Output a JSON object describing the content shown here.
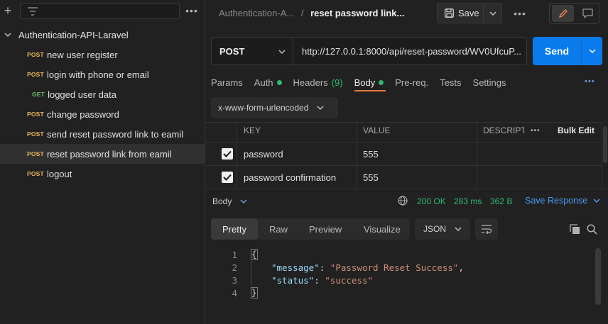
{
  "sidebar": {
    "collection_name": "Authentication-API-Laravel",
    "requests": [
      {
        "method": "POST",
        "name": "new user register"
      },
      {
        "method": "POST",
        "name": "login with phone or email"
      },
      {
        "method": "GET",
        "name": "logged user data"
      },
      {
        "method": "POST",
        "name": "change password"
      },
      {
        "method": "POST",
        "name": "send reset password link to eamil"
      },
      {
        "method": "POST",
        "name": "reset password link from eamil"
      },
      {
        "method": "POST",
        "name": "logout"
      }
    ]
  },
  "header": {
    "breadcrumb_parent": "Authentication-A...",
    "breadcrumb_sep": "/",
    "breadcrumb_current": "reset password link...",
    "save_label": "Save"
  },
  "request": {
    "method": "POST",
    "url": "http://127.0.0.1:8000/api/reset-password/WV0UfcuP...",
    "send_label": "Send",
    "tabs": [
      {
        "label": "Params"
      },
      {
        "label": "Auth"
      },
      {
        "label": "Headers",
        "count": "(9)"
      },
      {
        "label": "Body"
      },
      {
        "label": "Pre-req."
      },
      {
        "label": "Tests"
      },
      {
        "label": "Settings"
      }
    ],
    "body_encoding": "x-www-form-urlencoded",
    "table": {
      "headers": [
        "KEY",
        "VALUE",
        "DESCRIPT"
      ],
      "bulk_edit": "Bulk Edit",
      "rows": [
        {
          "key": "password",
          "value": "555"
        },
        {
          "key": "password confirmation",
          "value": "555"
        }
      ]
    }
  },
  "response": {
    "label": "Body",
    "status": "200 OK",
    "time": "283 ms",
    "size": "362 B",
    "save_label": "Save Response",
    "view_tabs": [
      "Pretty",
      "Raw",
      "Preview",
      "Visualize"
    ],
    "format": "JSON",
    "lines": [
      "1",
      "2",
      "3",
      "4"
    ],
    "json": {
      "open": "{",
      "close": "}",
      "k1": "\"message\"",
      "v1": "\"Password Reset Success\"",
      "k2": "\"status\"",
      "v2": "\"success\""
    }
  },
  "colors": {
    "accent": "#097bed",
    "post": "#e9b45a",
    "get": "#6ac06a",
    "success": "#2eb872",
    "active_tab": "#e87a3e"
  }
}
